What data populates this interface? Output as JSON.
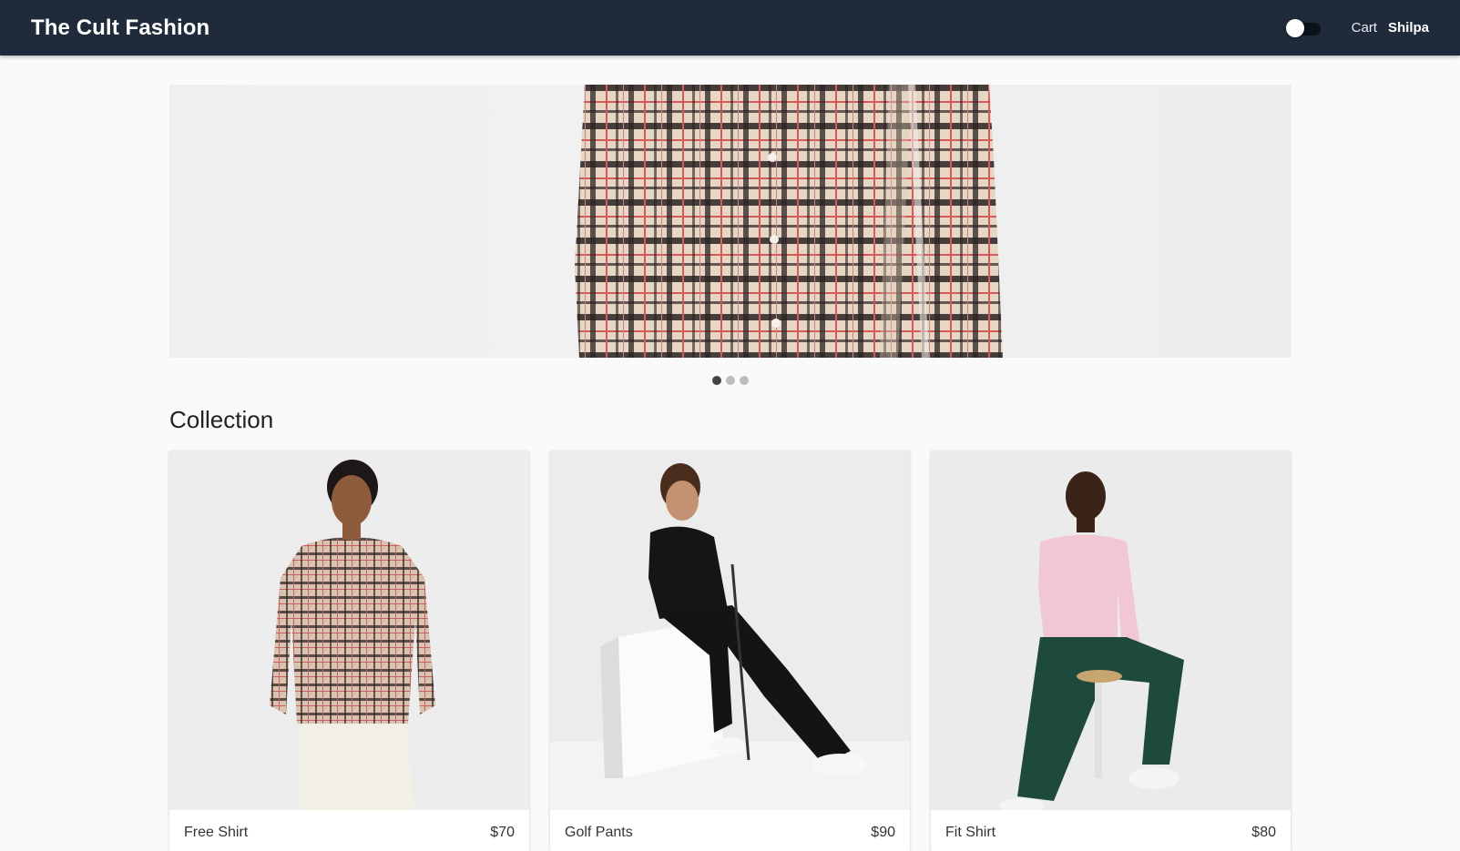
{
  "header": {
    "title": "The Cult Fashion",
    "theme_toggle": {
      "state": "off"
    },
    "cart_label": "Cart",
    "user_label": "Shilpa"
  },
  "hero": {
    "slide_count": 3,
    "active_slide": 1,
    "image": "plaid-shirt-closeup"
  },
  "collection": {
    "title": "Collection",
    "items": [
      {
        "name": "Free Shirt",
        "price": "$70",
        "image": "plaid-shirt-model"
      },
      {
        "name": "Golf Pants",
        "price": "$90",
        "image": "black-polo-golf-model"
      },
      {
        "name": "Fit Shirt",
        "price": "$80",
        "image": "pink-shirt-model"
      }
    ]
  },
  "colors": {
    "appbar": "#1f2a3a",
    "background": "#fafafa",
    "plaid_base": "#e7d6c3",
    "plaid_dark": "#2b2222",
    "plaid_red": "#d55a5a"
  }
}
